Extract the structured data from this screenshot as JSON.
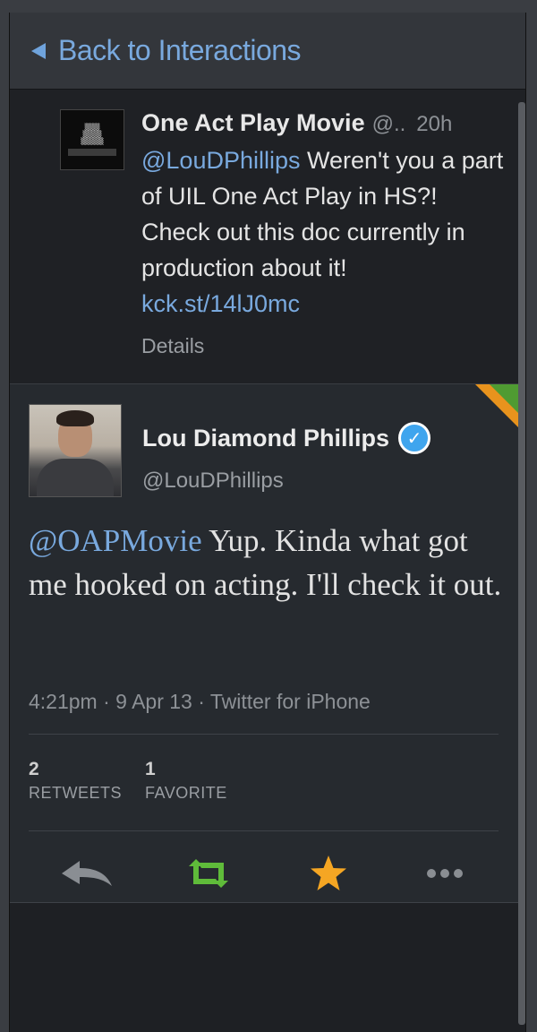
{
  "back": {
    "label": "Back to Interactions"
  },
  "original": {
    "name": "One Act Play Movie",
    "handle": "@..",
    "time": "20h",
    "mention": "@LouDPhillips",
    "text_before_link": " Weren't you a part of UIL One Act Play in HS?! Check out this doc currently in production about it! ",
    "link": "kck.st/14lJ0mc",
    "details": "Details"
  },
  "tweet": {
    "name": "Lou Diamond Phillips",
    "handle": "@LouDPhillips",
    "mention": "@OAPMovie",
    "text": " Yup. Kinda what got me hooked on acting. I'll check it out.",
    "timestamp": "4:21pm · 9 Apr 13 · Twitter for iPhone",
    "retweets_count": "2",
    "retweets_label": "RETWEETS",
    "favorites_count": "1",
    "favorites_label": "FAVORITE"
  },
  "colors": {
    "link": "#79a9de",
    "retweet_active": "#5fbb3a",
    "favorite_active": "#f5a623",
    "verified": "#3fa5ee"
  },
  "icons": [
    "back-arrow-icon",
    "verified-badge-icon",
    "reply-icon",
    "retweet-icon",
    "favorite-star-icon",
    "more-icon"
  ]
}
